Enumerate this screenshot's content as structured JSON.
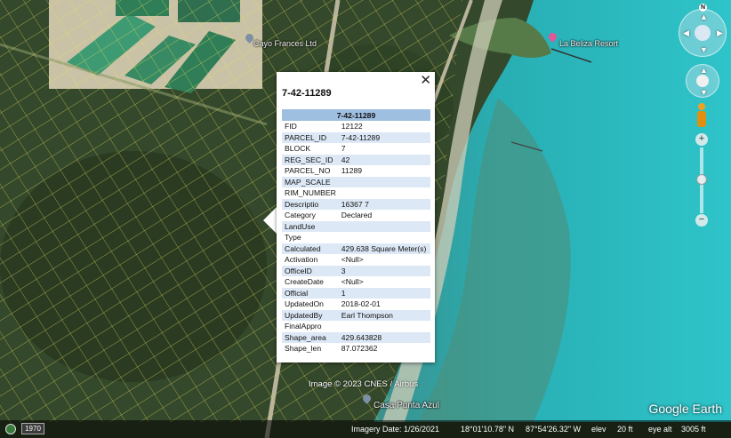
{
  "map": {
    "labels": {
      "cayo": "Cayo Frances Ltd",
      "resort": "La Beliza Resort",
      "casa": "Casa Punta Azul"
    },
    "credit": "Image © 2023 CNES / Airbus",
    "brand": "Google Earth"
  },
  "balloon": {
    "title": "7-42-11289",
    "close_icon": "close-icon",
    "table_header": "7-42-11289",
    "rows": [
      {
        "key": "FID",
        "value": "12122"
      },
      {
        "key": "PARCEL_ID",
        "value": "7-42-11289"
      },
      {
        "key": "BLOCK",
        "value": "7"
      },
      {
        "key": "REG_SEC_ID",
        "value": "42"
      },
      {
        "key": "PARCEL_NO",
        "value": "11289"
      },
      {
        "key": "MAP_SCALE",
        "value": ""
      },
      {
        "key": "RIM_NUMBER",
        "value": ""
      },
      {
        "key": "Descriptio",
        "value": "16367 7"
      },
      {
        "key": "Category",
        "value": "Declared"
      },
      {
        "key": "LandUse",
        "value": ""
      },
      {
        "key": "Type",
        "value": ""
      },
      {
        "key": "Calculated",
        "value": "429.638 Square Meter(s)"
      },
      {
        "key": "Activation",
        "value": "<Null>"
      },
      {
        "key": "OfficeID",
        "value": "3"
      },
      {
        "key": "CreateDate",
        "value": "<Null>"
      },
      {
        "key": "Official",
        "value": "1"
      },
      {
        "key": "UpdatedOn",
        "value": "2018-02-01"
      },
      {
        "key": "UpdatedBy",
        "value": "Earl Thompson"
      },
      {
        "key": "FinalAppro",
        "value": ""
      },
      {
        "key": "Shape_area",
        "value": "429.643828"
      },
      {
        "key": "Shape_len",
        "value": "87.072362"
      }
    ]
  },
  "controls": {
    "north_label": "N",
    "zoom_in": "+",
    "zoom_out": "−"
  },
  "statusbar": {
    "history_year": "1970",
    "imagery_date": "Imagery Date: 1/26/2021",
    "lat": "18°01'10.78\" N",
    "lon": "87°54'26.32\" W",
    "elev_label": "elev",
    "elev": "20 ft",
    "eye_label": "eye alt",
    "eye_alt": "3005 ft"
  },
  "colors": {
    "table_header": "#9fbfe0",
    "row_alt": "#dde8f6",
    "parcel_lines": "#e8e060",
    "sea": "#2fb5b8"
  }
}
